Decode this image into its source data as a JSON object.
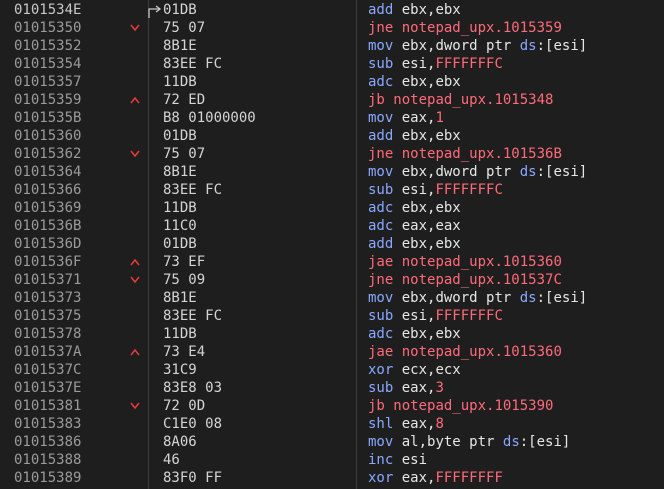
{
  "colors": {
    "background": "#1e1e1e",
    "address": "#9a9a9a",
    "bytes": "#d4d4d4",
    "mnemonic": "#8aa8ff",
    "jump": "#ff6a7a",
    "operand": "#e6e6e6",
    "jump_marker": "#e23a3a"
  },
  "rows": [
    {
      "addr": "0101534E",
      "jmp": "",
      "cursor": true,
      "bytes": "01DB",
      "mn": "add",
      "type": "normal",
      "ops": [
        {
          "t": "ebx,ebx",
          "c": "op"
        }
      ]
    },
    {
      "addr": "01015350",
      "jmp": "down",
      "bytes": "75 07",
      "mn": "jne",
      "type": "jump",
      "ops": [
        {
          "t": "notepad_upx.1015359",
          "c": "jop"
        }
      ]
    },
    {
      "addr": "01015352",
      "jmp": "",
      "bytes": "8B1E",
      "mn": "mov",
      "type": "normal",
      "ops": [
        {
          "t": "ebx,dword ptr ",
          "c": "op"
        },
        {
          "t": "ds",
          "c": "seg"
        },
        {
          "t": ":[esi]",
          "c": "op"
        }
      ]
    },
    {
      "addr": "01015354",
      "jmp": "",
      "bytes": "83EE FC",
      "mn": "sub",
      "type": "normal",
      "ops": [
        {
          "t": "esi,",
          "c": "op"
        },
        {
          "t": "FFFFFFFC",
          "c": "imm"
        }
      ]
    },
    {
      "addr": "01015357",
      "jmp": "",
      "bytes": "11DB",
      "mn": "adc",
      "type": "normal",
      "ops": [
        {
          "t": "ebx,ebx",
          "c": "op"
        }
      ]
    },
    {
      "addr": "01015359",
      "jmp": "up",
      "bytes": "72 ED",
      "mn": "jb",
      "type": "jump",
      "ops": [
        {
          "t": "notepad_upx.1015348",
          "c": "jop"
        }
      ]
    },
    {
      "addr": "0101535B",
      "jmp": "",
      "bytes": "B8 01000000",
      "mn": "mov",
      "type": "normal",
      "ops": [
        {
          "t": "eax,",
          "c": "op"
        },
        {
          "t": "1",
          "c": "imm"
        }
      ]
    },
    {
      "addr": "01015360",
      "jmp": "",
      "bytes": "01DB",
      "mn": "add",
      "type": "normal",
      "ops": [
        {
          "t": "ebx,ebx",
          "c": "op"
        }
      ]
    },
    {
      "addr": "01015362",
      "jmp": "down",
      "bytes": "75 07",
      "mn": "jne",
      "type": "jump",
      "ops": [
        {
          "t": "notepad_upx.101536B",
          "c": "jop"
        }
      ]
    },
    {
      "addr": "01015364",
      "jmp": "",
      "bytes": "8B1E",
      "mn": "mov",
      "type": "normal",
      "ops": [
        {
          "t": "ebx,dword ptr ",
          "c": "op"
        },
        {
          "t": "ds",
          "c": "seg"
        },
        {
          "t": ":[esi]",
          "c": "op"
        }
      ]
    },
    {
      "addr": "01015366",
      "jmp": "",
      "bytes": "83EE FC",
      "mn": "sub",
      "type": "normal",
      "ops": [
        {
          "t": "esi,",
          "c": "op"
        },
        {
          "t": "FFFFFFFC",
          "c": "imm"
        }
      ]
    },
    {
      "addr": "01015369",
      "jmp": "",
      "bytes": "11DB",
      "mn": "adc",
      "type": "normal",
      "ops": [
        {
          "t": "ebx,ebx",
          "c": "op"
        }
      ]
    },
    {
      "addr": "0101536B",
      "jmp": "",
      "bytes": "11C0",
      "mn": "adc",
      "type": "normal",
      "ops": [
        {
          "t": "eax,eax",
          "c": "op"
        }
      ]
    },
    {
      "addr": "0101536D",
      "jmp": "",
      "bytes": "01DB",
      "mn": "add",
      "type": "normal",
      "ops": [
        {
          "t": "ebx,ebx",
          "c": "op"
        }
      ]
    },
    {
      "addr": "0101536F",
      "jmp": "up",
      "bytes": "73 EF",
      "mn": "jae",
      "type": "jump",
      "ops": [
        {
          "t": "notepad_upx.1015360",
          "c": "jop"
        }
      ]
    },
    {
      "addr": "01015371",
      "jmp": "down",
      "bytes": "75 09",
      "mn": "jne",
      "type": "jump",
      "ops": [
        {
          "t": "notepad_upx.101537C",
          "c": "jop"
        }
      ]
    },
    {
      "addr": "01015373",
      "jmp": "",
      "bytes": "8B1E",
      "mn": "mov",
      "type": "normal",
      "ops": [
        {
          "t": "ebx,dword ptr ",
          "c": "op"
        },
        {
          "t": "ds",
          "c": "seg"
        },
        {
          "t": ":[esi]",
          "c": "op"
        }
      ]
    },
    {
      "addr": "01015375",
      "jmp": "",
      "bytes": "83EE FC",
      "mn": "sub",
      "type": "normal",
      "ops": [
        {
          "t": "esi,",
          "c": "op"
        },
        {
          "t": "FFFFFFFC",
          "c": "imm"
        }
      ]
    },
    {
      "addr": "01015378",
      "jmp": "",
      "bytes": "11DB",
      "mn": "adc",
      "type": "normal",
      "ops": [
        {
          "t": "ebx,ebx",
          "c": "op"
        }
      ]
    },
    {
      "addr": "0101537A",
      "jmp": "up",
      "bytes": "73 E4",
      "mn": "jae",
      "type": "jump",
      "ops": [
        {
          "t": "notepad_upx.1015360",
          "c": "jop"
        }
      ]
    },
    {
      "addr": "0101537C",
      "jmp": "",
      "bytes": "31C9",
      "mn": "xor",
      "type": "normal",
      "ops": [
        {
          "t": "ecx,ecx",
          "c": "op"
        }
      ]
    },
    {
      "addr": "0101537E",
      "jmp": "",
      "bytes": "83E8 03",
      "mn": "sub",
      "type": "normal",
      "ops": [
        {
          "t": "eax,",
          "c": "op"
        },
        {
          "t": "3",
          "c": "imm"
        }
      ]
    },
    {
      "addr": "01015381",
      "jmp": "down",
      "bytes": "72 0D",
      "mn": "jb",
      "type": "jump",
      "ops": [
        {
          "t": "notepad_upx.1015390",
          "c": "jop"
        }
      ]
    },
    {
      "addr": "01015383",
      "jmp": "",
      "bytes": "C1E0 08",
      "mn": "shl",
      "type": "normal",
      "ops": [
        {
          "t": "eax,",
          "c": "op"
        },
        {
          "t": "8",
          "c": "imm"
        }
      ]
    },
    {
      "addr": "01015386",
      "jmp": "",
      "bytes": "8A06",
      "mn": "mov",
      "type": "normal",
      "ops": [
        {
          "t": "al,byte ptr ",
          "c": "op"
        },
        {
          "t": "ds",
          "c": "seg"
        },
        {
          "t": ":[esi]",
          "c": "op"
        }
      ]
    },
    {
      "addr": "01015388",
      "jmp": "",
      "bytes": "46",
      "mn": "inc",
      "type": "normal",
      "ops": [
        {
          "t": "esi",
          "c": "op"
        }
      ]
    },
    {
      "addr": "01015389",
      "jmp": "",
      "bytes": "83F0 FF",
      "mn": "xor",
      "type": "normal",
      "ops": [
        {
          "t": "eax,",
          "c": "op"
        },
        {
          "t": "FFFFFFFF",
          "c": "imm"
        }
      ]
    }
  ]
}
